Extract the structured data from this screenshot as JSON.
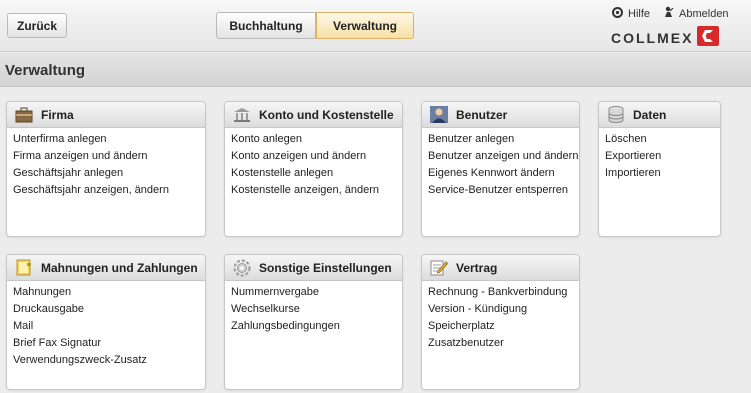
{
  "header": {
    "back_label": "Zurück",
    "tabs": [
      {
        "label": "Buchhaltung"
      },
      {
        "label": "Verwaltung"
      }
    ],
    "help_label": "Hilfe",
    "logout_label": "Abmelden",
    "logo_text": "COLLMEX"
  },
  "page": {
    "title": "Verwaltung"
  },
  "cards": [
    {
      "title": "Firma",
      "icon": "company-icon",
      "items": [
        "Unterfirma anlegen",
        "Firma anzeigen und ändern",
        "Geschäftsjahr anlegen",
        "Geschäftsjahr anzeigen, ändern"
      ]
    },
    {
      "title": "Konto und Kostenstelle",
      "icon": "bank-icon",
      "items": [
        "Konto anlegen",
        "Konto anzeigen und ändern",
        "Kostenstelle anlegen",
        "Kostenstelle anzeigen, ändern"
      ]
    },
    {
      "title": "Benutzer",
      "icon": "user-icon",
      "items": [
        "Benutzer anlegen",
        "Benutzer anzeigen und ändern",
        "Eigenes Kennwort ändern",
        "Service-Benutzer entsperren"
      ]
    },
    {
      "title": "Daten",
      "icon": "database-icon",
      "items": [
        "Löschen",
        "Exportieren",
        "Importieren"
      ]
    },
    {
      "title": "Mahnungen und Zahlungen",
      "icon": "folder-icon",
      "items": [
        "Mahnungen",
        "Druckausgabe",
        "Mail",
        "Brief Fax Signatur",
        "Verwendungszweck-Zusatz"
      ]
    },
    {
      "title": "Sonstige Einstellungen",
      "icon": "gear-icon",
      "items": [
        "Nummernvergabe",
        "Wechselkurse",
        "Zahlungsbedingungen"
      ]
    },
    {
      "title": "Vertrag",
      "icon": "contract-icon",
      "items": [
        "Rechnung - Bankverbindung",
        "Version - Kündigung",
        "Speicherplatz",
        "Zusatzbenutzer"
      ]
    }
  ],
  "colors": {
    "active_tab": "#f7dfa6",
    "logo_red": "#d62a2a"
  }
}
